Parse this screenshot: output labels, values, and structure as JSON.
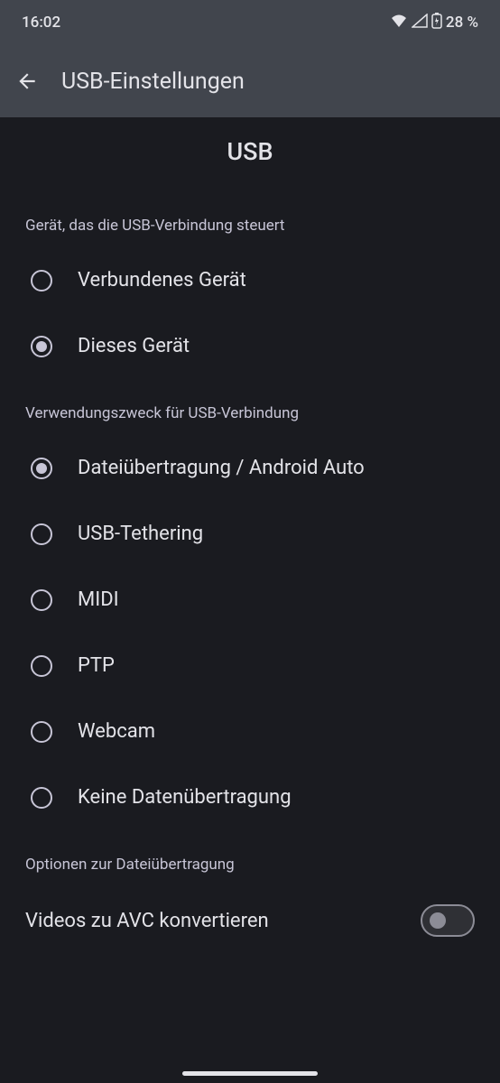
{
  "status_bar": {
    "time": "16:02",
    "battery": "28 %"
  },
  "app_bar": {
    "title": "USB-Einstellungen"
  },
  "header": "USB",
  "sections": {
    "controller": {
      "title": "Gerät, das die USB-Verbindung steuert",
      "options": [
        {
          "label": "Verbundenes Gerät",
          "selected": false
        },
        {
          "label": "Dieses Gerät",
          "selected": true
        }
      ]
    },
    "purpose": {
      "title": "Verwendungszweck für USB-Verbindung",
      "options": [
        {
          "label": "Dateiübertragung / Android Auto",
          "selected": true
        },
        {
          "label": "USB-Tethering",
          "selected": false
        },
        {
          "label": "MIDI",
          "selected": false
        },
        {
          "label": "PTP",
          "selected": false
        },
        {
          "label": "Webcam",
          "selected": false
        },
        {
          "label": "Keine Datenübertragung",
          "selected": false
        }
      ]
    },
    "file_options": {
      "title": "Optionen zur Dateiübertragung",
      "avc_label": "Videos zu AVC konvertieren",
      "avc_enabled": false
    }
  }
}
